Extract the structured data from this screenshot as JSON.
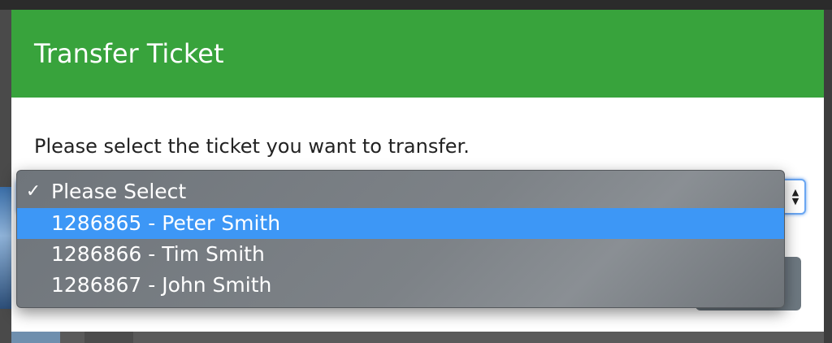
{
  "modal": {
    "title": "Transfer Ticket",
    "prompt": "Please select the ticket you want to transfer."
  },
  "select": {
    "selected_value": "Please Select",
    "options": [
      {
        "label": "Please Select",
        "checked": true,
        "highlighted": false
      },
      {
        "label": "1286865 - Peter Smith",
        "checked": false,
        "highlighted": true
      },
      {
        "label": "1286866 - Tim Smith",
        "checked": false,
        "highlighted": false
      },
      {
        "label": "1286867 - John Smith",
        "checked": false,
        "highlighted": false
      }
    ],
    "check_glyph": "✓",
    "arrows_glyph_up": "▲",
    "arrows_glyph_down": "▼"
  },
  "colors": {
    "header_green": "#38a33c",
    "highlight_blue": "#3d97f6",
    "button_gray": "#6d7880"
  },
  "icons": {
    "check": "check-icon",
    "select_arrows": "select-arrows-icon"
  }
}
